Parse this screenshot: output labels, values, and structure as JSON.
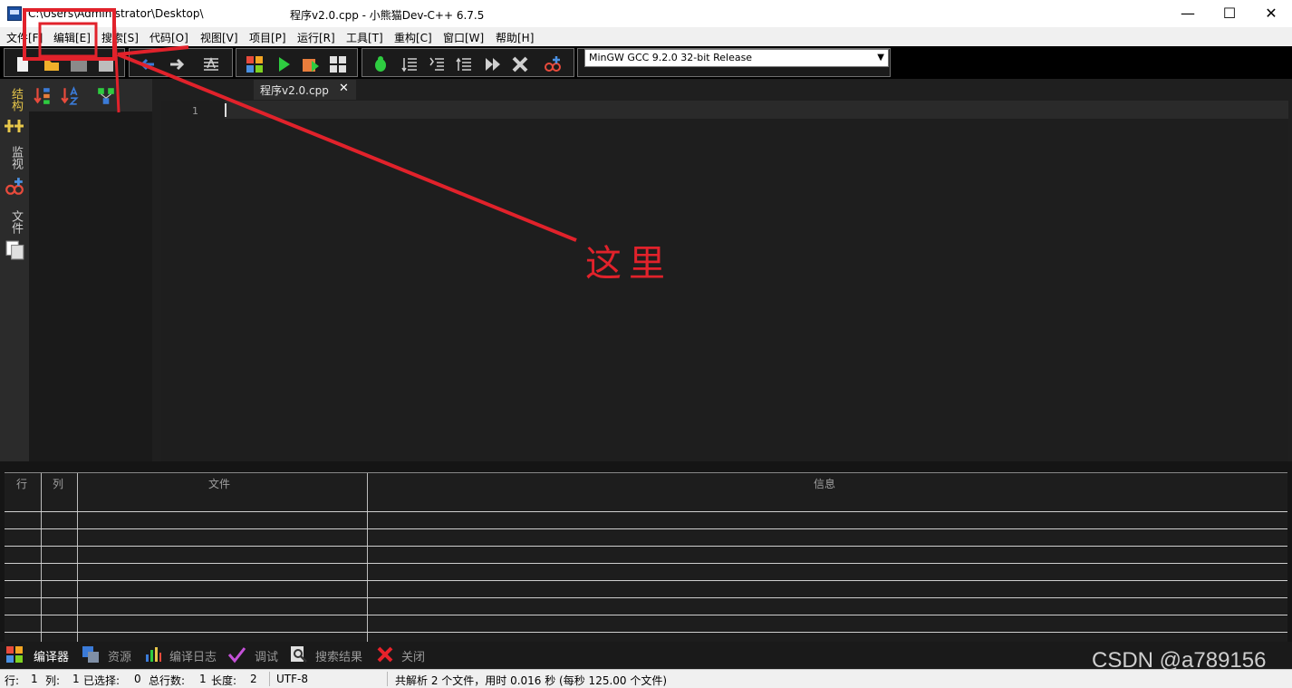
{
  "window": {
    "path": "C:\\Users\\Administrator\\Desktop\\",
    "title": "程序v2.0.cpp - 小熊猫Dev-C++ 6.7.5",
    "minimize": "—",
    "maximize": "☐",
    "close": "✕"
  },
  "menu": [
    "文件[F]",
    "编辑[E]",
    "搜索[S]",
    "代码[O]",
    "视图[V]",
    "项目[P]",
    "运行[R]",
    "工具[T]",
    "重构[C]",
    "窗口[W]",
    "帮助[H]"
  ],
  "toolbar": {
    "compiler": "MinGW GCC 9.2.0 32-bit Release"
  },
  "side_tabs": [
    "结构",
    "监视",
    "文件"
  ],
  "editor": {
    "tab_name": "程序v2.0.cpp",
    "tab_close": "✕",
    "line_number": "1"
  },
  "messages": {
    "columns": [
      "行",
      "列",
      "文件",
      "信息"
    ]
  },
  "bottom_tabs": [
    "编译器",
    "资源",
    "编译日志",
    "调试",
    "搜索结果",
    "关闭"
  ],
  "status": {
    "row_label": "行:",
    "row": "1",
    "col_label": "列:",
    "col": "1",
    "sel_label": "已选择:",
    "sel": "0",
    "lines_label": "总行数:",
    "lines": "1",
    "len_label": "长度:",
    "len": "2",
    "encoding": "UTF-8",
    "parse_info": "共解析 2 个文件，用时 0.016 秒 (每秒 125.00 个文件)"
  },
  "annotation": "这里",
  "watermark": "CSDN @a789156",
  "colors": {
    "annotation": "#e1222b",
    "editor_bg": "#1e1e1e"
  }
}
